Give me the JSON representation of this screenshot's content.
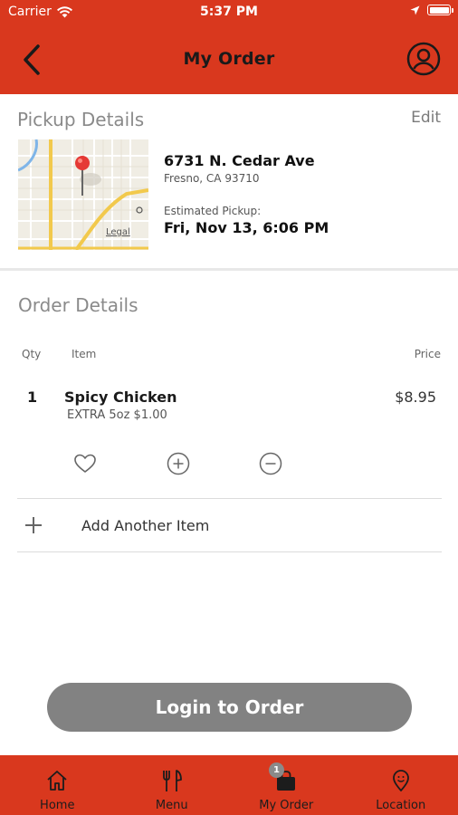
{
  "status_bar": {
    "carrier": "Carrier",
    "time": "5:37 PM"
  },
  "nav": {
    "title": "My Order"
  },
  "pickup": {
    "title": "Pickup Details",
    "edit_label": "Edit",
    "map_legal": "Legal",
    "address_line1": "6731 N. Cedar Ave",
    "address_line2": "Fresno, CA 93710",
    "estimated_label": "Estimated Pickup:",
    "estimated_value": "Fri, Nov 13, 6:06 PM"
  },
  "order": {
    "title": "Order Details",
    "columns": {
      "qty": "Qty",
      "item": "Item",
      "price": "Price"
    },
    "items": [
      {
        "qty": "1",
        "name": "Spicy Chicken",
        "modifier": "EXTRA 5oz $1.00",
        "price": "$8.95"
      }
    ],
    "add_item_label": "Add Another Item"
  },
  "login_button": "Login to Order",
  "tabs": [
    {
      "label": "Home",
      "icon": "home-icon"
    },
    {
      "label": "Menu",
      "icon": "fork-knife-icon"
    },
    {
      "label": "My Order",
      "icon": "bag-icon",
      "badge": "1"
    },
    {
      "label": "Location",
      "icon": "location-pin-icon"
    }
  ],
  "colors": {
    "brand_red": "#d9381e",
    "button_gray": "#828282"
  }
}
